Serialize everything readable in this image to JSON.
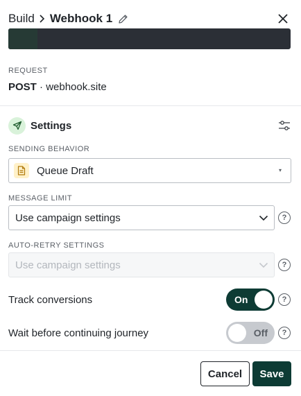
{
  "header": {
    "breadcrumb_root": "Build",
    "title": "Webhook 1",
    "icons": {
      "separator": "chevron-right-icon",
      "edit": "pencil-icon",
      "close": "close-icon"
    }
  },
  "request": {
    "label": "REQUEST",
    "method": "POST",
    "separator": "·",
    "host": "webhook.site"
  },
  "settings": {
    "title": "Settings",
    "icons": {
      "section": "send-icon",
      "options": "sliders-icon"
    }
  },
  "sending_behavior": {
    "label": "SENDING BEHAVIOR",
    "value": "Queue Draft",
    "caret": "▾"
  },
  "message_limit": {
    "label": "MESSAGE LIMIT",
    "value": "Use campaign settings",
    "help": "?"
  },
  "auto_retry": {
    "label": "AUTO-RETRY SETTINGS",
    "value": "Use campaign settings",
    "disabled": true,
    "help": "?"
  },
  "track_conversions": {
    "label": "Track conversions",
    "state": "On",
    "enabled": true,
    "help": "?"
  },
  "wait_before_continuing": {
    "label": "Wait before continuing journey",
    "state": "Off",
    "enabled": false,
    "help": "?"
  },
  "footer": {
    "cancel_label": "Cancel",
    "save_label": "Save"
  },
  "colors": {
    "primary": "#0d3b34",
    "settings_icon_bg": "#d9f2da",
    "draft_icon_bg": "#fff1c9",
    "preview_bar": "#2b2f36"
  }
}
